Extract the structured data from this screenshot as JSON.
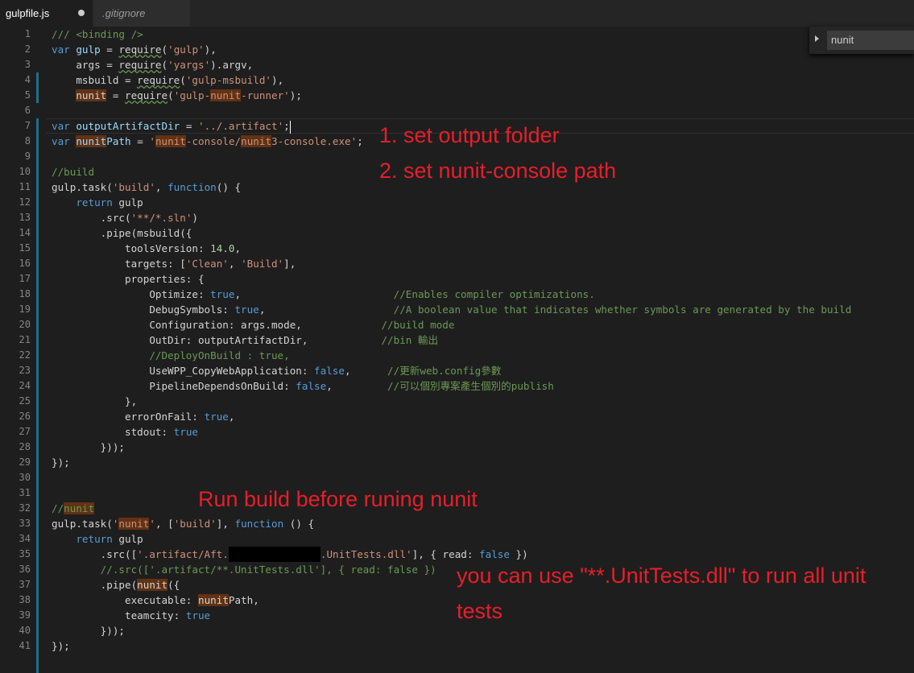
{
  "tabs": [
    {
      "label": "gulpfile.js",
      "active": true,
      "dirty": true
    },
    {
      "label": ".gitignore",
      "active": false
    }
  ],
  "find_widget": {
    "value": "nunit"
  },
  "line_numbers": [
    "1",
    "2",
    "3",
    "4",
    "5",
    "6",
    "7",
    "8",
    "9",
    "10",
    "11",
    "12",
    "13",
    "14",
    "15",
    "16",
    "17",
    "18",
    "19",
    "20",
    "21",
    "22",
    "23",
    "24",
    "25",
    "26",
    "27",
    "28",
    "29",
    "30",
    "31",
    "32",
    "33",
    "34",
    "35",
    "36",
    "37",
    "38",
    "39",
    "40",
    "41"
  ],
  "code": {
    "l1": "/// <binding />",
    "l2_kw": "var",
    "l2_a": "gulp",
    "l2_b": " = ",
    "l2_c": "require",
    "l2_d": "(",
    "l2_e": "'gulp'",
    "l2_f": "),",
    "l3_a": "    args = ",
    "l3_b": "require",
    "l3_c": "(",
    "l3_d": "'yargs'",
    "l3_e": ").argv,",
    "l4_a": "    msbuild = ",
    "l4_b": "require",
    "l4_c": "(",
    "l4_d": "'gulp-msbuild'",
    "l4_e": "),",
    "l5_a": "    ",
    "l5_b": "nunit",
    "l5_c": " = ",
    "l5_d": "require",
    "l5_e": "(",
    "l5_f": "'gulp-",
    "l5_g": "nunit",
    "l5_h": "-runner'",
    "l5_i": ");",
    "l7_kw": "var",
    "l7_a": "outputArtifactDir",
    "l7_b": " = ",
    "l7_c": "'../.artifact'",
    "l7_d": ";",
    "l8_kw": "var",
    "l8_a": "nunit",
    "l8_b": "Path",
    "l8_c": " = ",
    "l8_d": "'",
    "l8_e": "nunit",
    "l8_f": "-console/",
    "l8_g": "nunit",
    "l8_h": "3-console.exe'",
    "l8_i": ";",
    "l10": "//build",
    "l11_a": "gulp.task(",
    "l11_b": "'build'",
    "l11_c": ", ",
    "l11_d": "function",
    "l11_e": "() {",
    "l12_a": "    ",
    "l12_b": "return",
    "l12_c": " gulp",
    "l13_a": "        .src(",
    "l13_b": "'**/*.sln'",
    "l13_c": ")",
    "l14": "        .pipe(msbuild({",
    "l15_a": "            toolsVersion: ",
    "l15_b": "14.0",
    "l15_c": ",",
    "l16_a": "            targets: [",
    "l16_b": "'Clean'",
    "l16_c": ", ",
    "l16_d": "'Build'",
    "l16_e": "],",
    "l17": "            properties: {",
    "l18_a": "                Optimize: ",
    "l18_b": "true",
    "l18_c": ",                         ",
    "l18_d": "//Enables compiler optimizations.",
    "l19_a": "                DebugSymbols: ",
    "l19_b": "true",
    "l19_c": ",                     ",
    "l19_d": "//A boolean value that indicates whether symbols are generated by the build",
    "l20_a": "                Configuration: args.mode,             ",
    "l20_b": "//build mode",
    "l21_a": "                OutDir: outputArtifactDir,            ",
    "l21_b": "//bin 輸出",
    "l22": "                //DeployOnBuild : true,",
    "l23_a": "                UseWPP_CopyWebApplication: ",
    "l23_b": "false",
    "l23_c": ",      ",
    "l23_d": "//更新web.config參數",
    "l24_a": "                PipelineDependsOnBuild: ",
    "l24_b": "false",
    "l24_c": ",         ",
    "l24_d": "//可以個別專案產生個別的publish",
    "l25": "            },",
    "l26_a": "            errorOnFail: ",
    "l26_b": "true",
    "l26_c": ",",
    "l27_a": "            stdout: ",
    "l27_b": "true",
    "l28": "        }));",
    "l29": "});",
    "l32_a": "//",
    "l32_b": "nunit",
    "l33_a": "gulp.task(",
    "l33_b": "'",
    "l33_c": "nunit",
    "l33_d": "'",
    "l33_e": ", [",
    "l33_f": "'build'",
    "l33_g": "], ",
    "l33_h": "function",
    "l33_i": " () {",
    "l34_a": "    ",
    "l34_b": "return",
    "l34_c": " gulp",
    "l35_a": "        .src([",
    "l35_b": "'.artifact/Aft.",
    "l35_c": ".UnitTests.dll'",
    "l35_d": "], { read: ",
    "l35_e": "false",
    "l35_f": " })",
    "l36": "        //.src(['.artifact/**.UnitTests.dll'], { read: false })",
    "l37_a": "        .pipe(",
    "l37_b": "nunit",
    "l37_c": "({",
    "l38_a": "            executable: ",
    "l38_b": "nunit",
    "l38_c": "Path,",
    "l39_a": "            teamcity: ",
    "l39_b": "true",
    "l40": "        }));",
    "l41": "});"
  },
  "annotations": {
    "a1": "1. set output folder",
    "a2": "2. set nunit-console path",
    "a3": "Run build before runing nunit",
    "a4_line1": "you can use \"**.UnitTests.dll\" to run all unit",
    "a4_line2": "tests"
  },
  "colors": {
    "annotation": "#e81e2a",
    "editor_bg": "#1e1e1e",
    "find_highlight": "#613214"
  }
}
